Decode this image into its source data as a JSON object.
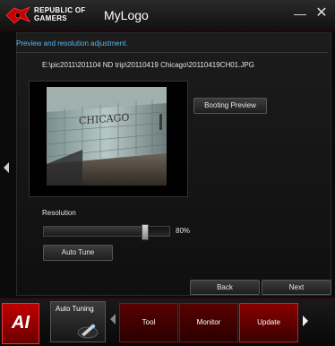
{
  "window": {
    "brand_line1": "REPUBLIC OF",
    "brand_line2": "GAMERS",
    "title": "MyLogo",
    "min_symbol": "—",
    "close_symbol": "✕"
  },
  "main": {
    "section_title": "Preview and resolution adjustment.",
    "file_path": "E:\\pic2011\\201104 ND trip\\20110419 Chicago\\20110419CH01.JPG",
    "preview_sign": "CHICAGO",
    "booting_preview_label": "Booting Preview",
    "resolution_label": "Resolution",
    "resolution_value": "80%",
    "resolution_fraction": 0.8,
    "auto_tune_label": "Auto Tune",
    "back_label": "Back",
    "next_label": "Next"
  },
  "bottom": {
    "auto_tuning_label": "Auto Tuning",
    "tabs": [
      {
        "label": "Tool"
      },
      {
        "label": "Monitor"
      },
      {
        "label": "Update"
      }
    ]
  },
  "colors": {
    "accent_red": "#8a0000",
    "section_blue": "#58b6f0"
  }
}
